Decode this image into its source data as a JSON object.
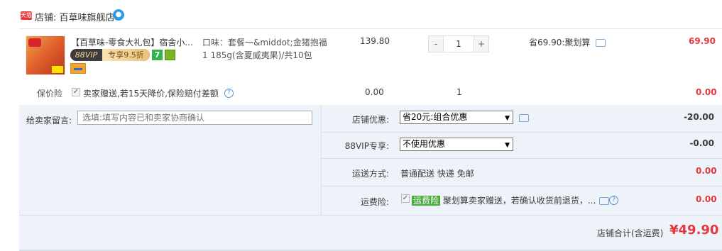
{
  "shop": {
    "badge": "天猫",
    "label": "店铺: 百草味旗舰店",
    "ww_icon": "chat-bubble-icon"
  },
  "item": {
    "title": "【百草味-零食大礼包】宿舍小...",
    "vip_left": "88VIP",
    "vip_right": "专享9.5折",
    "seven_badge": "7",
    "flavor": "口味：套餐一&middot;金猪抱福1 185g(含夏威夷果)/共10包",
    "price": "139.80",
    "qty_minus": "-",
    "qty_value": "1",
    "qty_plus": "+",
    "promo": "省69.90:聚划算",
    "subtotal": "69.90"
  },
  "insurance": {
    "label": "保价险",
    "check": "✓",
    "text": "卖家赠送,若15天降价,保险赔付差额",
    "price": "0.00",
    "qty": "1",
    "subtotal": "0.00",
    "help": "?"
  },
  "message": {
    "label": "给卖家留言:",
    "placeholder": "选填:填写内容已和卖家协商确认"
  },
  "shop_discount": {
    "label": "店铺优惠:",
    "selected": "省20元:组合优惠",
    "value": "-20.00"
  },
  "vip_discount": {
    "label": "88VIP专享:",
    "selected": "不使用优惠",
    "value": "-0.00"
  },
  "shipping": {
    "label": "运送方式:",
    "text": "普通配送 快递 免邮",
    "value": "0.00"
  },
  "freight_ins": {
    "label": "运费险:",
    "check": "✓",
    "tag": "运费险",
    "text": "聚划算卖家赠送，若确认收货前退货，...",
    "value": "0.00",
    "help": "?"
  },
  "total": {
    "label": "店铺合计(含运费)",
    "amount": "¥49.90"
  },
  "colors": {
    "accent_red": "#e4393c",
    "panel_bg": "#eef2f9"
  }
}
